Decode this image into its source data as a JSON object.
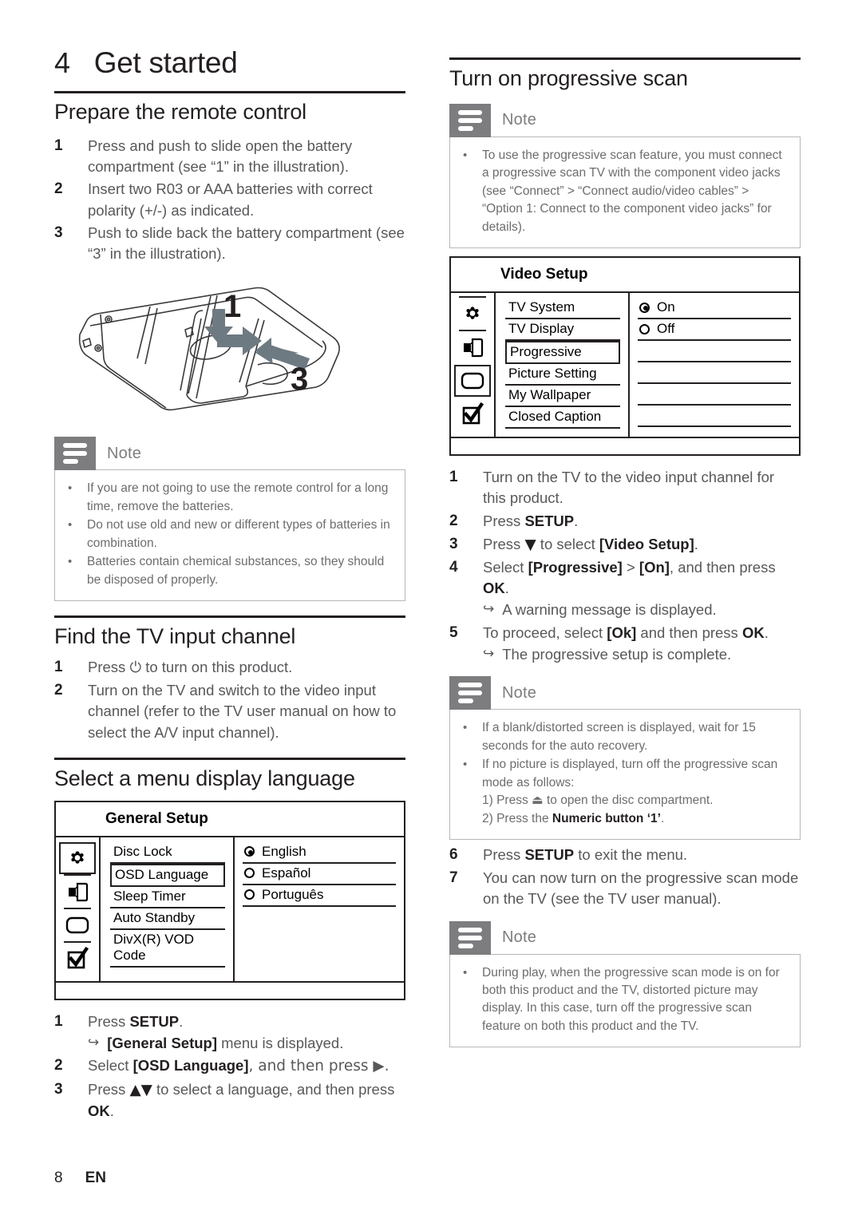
{
  "chapter": {
    "number": "4",
    "title": "Get started"
  },
  "left": {
    "section1": {
      "heading": "Prepare the remote control",
      "steps": [
        {
          "num": "1",
          "text": "Press and push to slide open the battery compartment (see “1” in the illustration)."
        },
        {
          "num": "2",
          "text": "Insert two R03 or AAA batteries with correct polarity (+/-) as indicated."
        },
        {
          "num": "3",
          "text": "Push to slide back the battery compartment (see “3” in the illustration)."
        }
      ],
      "illustration": {
        "name": "remote-battery-compartment-illustration",
        "callout_1": "1",
        "callout_3": "3"
      },
      "note": {
        "label": "Note",
        "items": [
          "If you are not going to use the remote control for a long time, remove the batteries.",
          "Do not use old and new or different types of batteries in combination.",
          "Batteries contain chemical substances, so they should be disposed of properly."
        ]
      }
    },
    "section2": {
      "heading": "Find the TV input channel",
      "steps": [
        {
          "num": "1",
          "text_before": "Press ",
          "symbol": "⏻",
          "text_after": " to turn on this product."
        },
        {
          "num": "2",
          "text": "Turn on the TV and switch to the video input channel (refer to the TV user manual on how to select the A/V input channel)."
        }
      ]
    },
    "section3": {
      "heading": "Select a menu display language",
      "osd": {
        "title": "General Setup",
        "icons": [
          {
            "name": "gear-icon",
            "selected": true
          },
          {
            "name": "speaker-icon",
            "selected": false
          },
          {
            "name": "tv-display-icon",
            "selected": false
          },
          {
            "name": "checkbox-check-icon",
            "selected": false
          }
        ],
        "menu_items": [
          {
            "label": "Disc Lock",
            "highlighted": false
          },
          {
            "label": "OSD Language",
            "highlighted": true
          },
          {
            "label": "Sleep Timer",
            "highlighted": false
          },
          {
            "label": "Auto Standby",
            "highlighted": false
          },
          {
            "label": "DivX(R) VOD Code",
            "highlighted": false
          }
        ],
        "options": [
          {
            "label": "English",
            "selected": true
          },
          {
            "label": "Español",
            "selected": false
          },
          {
            "label": "Português",
            "selected": false
          }
        ]
      },
      "steps": [
        {
          "num": "1",
          "text_before": "Press ",
          "bold": "SETUP",
          "text_after": ".",
          "sub": {
            "arrow": "↪",
            "bold": "[General Setup]",
            "after": " menu is displayed."
          }
        },
        {
          "num": "2",
          "text_before": "Select ",
          "bold": "[OSD Language]",
          "text_after": ", and then press ▶."
        },
        {
          "num": "3",
          "text_before": "Press ",
          "symbol": "▲▼",
          "text_mid": " to select a language, and then press ",
          "bold2": "OK",
          "text_after": "."
        }
      ]
    }
  },
  "right": {
    "heading": "Turn on progressive scan",
    "note1": {
      "label": "Note",
      "items": [
        "To use the progressive scan feature, you must connect a progressive scan TV with the component video jacks (see “Connect” > “Connect audio/video cables” > “Option 1: Connect to the component video jacks” for details)."
      ]
    },
    "osd": {
      "title": "Video Setup",
      "icons": [
        {
          "name": "gear-icon",
          "selected": false
        },
        {
          "name": "speaker-icon",
          "selected": false
        },
        {
          "name": "tv-display-icon",
          "selected": true
        },
        {
          "name": "checkbox-check-icon",
          "selected": false
        }
      ],
      "menu_items": [
        {
          "label": "TV System",
          "highlighted": false
        },
        {
          "label": "TV Display",
          "highlighted": false
        },
        {
          "label": "Progressive",
          "highlighted": true
        },
        {
          "label": "Picture Setting",
          "highlighted": false
        },
        {
          "label": "My Wallpaper",
          "highlighted": false
        },
        {
          "label": "Closed Caption",
          "highlighted": false
        }
      ],
      "options": [
        {
          "label": "On",
          "selected": true
        },
        {
          "label": "Off",
          "selected": false
        }
      ]
    },
    "steps": [
      {
        "num": "1",
        "text": "Turn on the TV to the video input channel for this product."
      },
      {
        "num": "2",
        "text_before": "Press ",
        "bold": "SETUP",
        "text_after": "."
      },
      {
        "num": "3",
        "text_before": "Press ",
        "symbol": "▼",
        "text_mid": " to select ",
        "bold2": "[Video Setup]",
        "text_after": "."
      },
      {
        "num": "4",
        "text_before": "Select ",
        "bold": "[Progressive]",
        "text_mid": " > ",
        "bold2": "[On]",
        "text_after": ", and then press ",
        "bold3": "OK",
        "text_end": ".",
        "sub": {
          "arrow": "↪",
          "text": "A warning message is displayed."
        }
      },
      {
        "num": "5",
        "text_before": "To proceed, select ",
        "bold": "[Ok]",
        "text_mid": " and then press ",
        "bold2": "OK",
        "text_after": ".",
        "sub": {
          "arrow": "↪",
          "text": "The progressive setup is complete."
        }
      }
    ],
    "note2": {
      "label": "Note",
      "items": [
        "If a blank/distorted screen is displayed, wait for 15 seconds for the auto recovery.",
        "If no picture is displayed, turn off the progressive scan mode as follows:"
      ],
      "sub_items": [
        {
          "text_before": "1) Press ⏏ to open the disc compartment."
        },
        {
          "text_before": "2) Press the ",
          "bold": "Numeric button ‘1’",
          "text_after": "."
        }
      ]
    },
    "steps2": [
      {
        "num": "6",
        "text_before": "Press ",
        "bold": "SETUP",
        "text_after": " to exit the menu."
      },
      {
        "num": "7",
        "text": "You can now turn on the progressive scan mode on the TV (see the TV user manual)."
      }
    ],
    "note3": {
      "label": "Note",
      "items": [
        "During play, when the progressive scan mode is on for both this product and the TV, distorted picture may display. In this case, turn off the progressive scan feature on both this product and the TV."
      ]
    }
  },
  "footer": {
    "page": "8",
    "language": "EN"
  },
  "colors": {
    "heading": "#231f20",
    "body": "#58585b",
    "note_gray": "#7d7d80",
    "note_border": "#b8b8bb",
    "arrow_fill": "#6e7a82"
  }
}
